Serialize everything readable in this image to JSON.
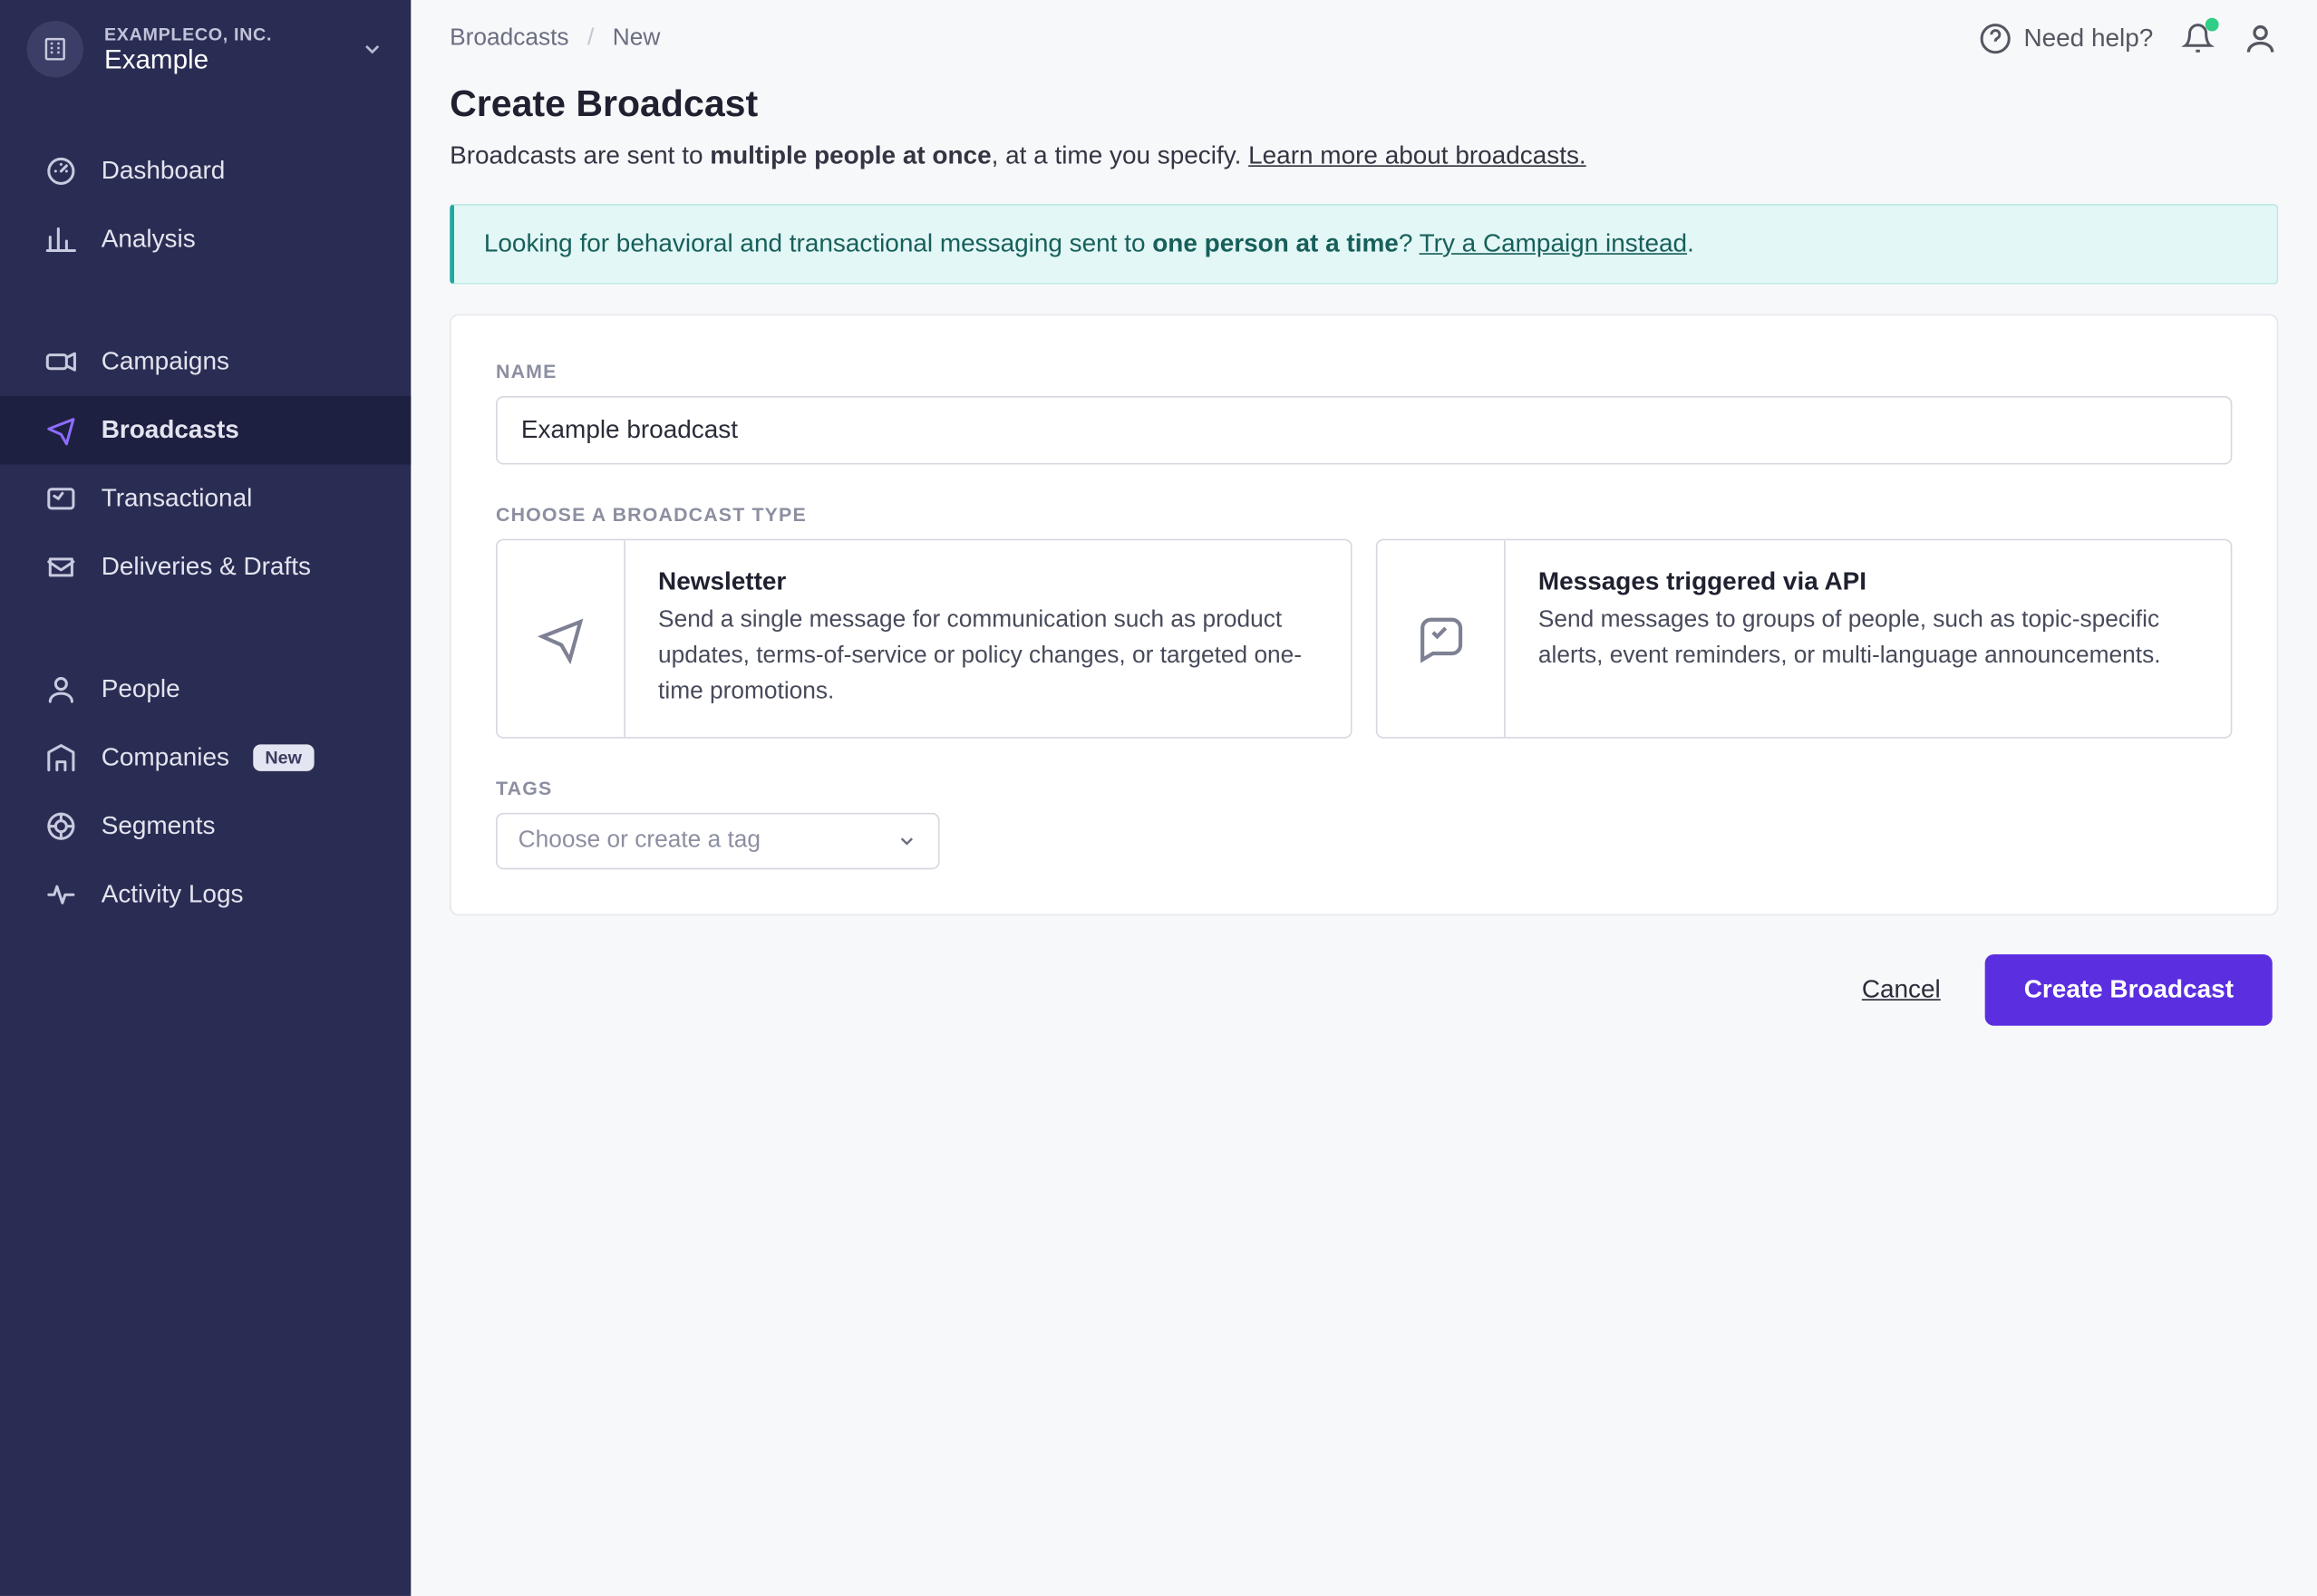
{
  "workspace": {
    "parent": "EXAMPLECO, INC.",
    "name": "Example"
  },
  "sidebar": {
    "groups": [
      [
        {
          "icon": "dashboard",
          "label": "Dashboard"
        },
        {
          "icon": "analysis",
          "label": "Analysis"
        }
      ],
      [
        {
          "icon": "campaigns",
          "label": "Campaigns"
        },
        {
          "icon": "broadcasts",
          "label": "Broadcasts",
          "active": true
        },
        {
          "icon": "transactional",
          "label": "Transactional"
        },
        {
          "icon": "deliveries",
          "label": "Deliveries & Drafts"
        }
      ],
      [
        {
          "icon": "people",
          "label": "People"
        },
        {
          "icon": "companies",
          "label": "Companies",
          "badge": "New"
        },
        {
          "icon": "segments",
          "label": "Segments"
        },
        {
          "icon": "activitylogs",
          "label": "Activity Logs"
        }
      ]
    ]
  },
  "breadcrumb": {
    "root": "Broadcasts",
    "current": "New"
  },
  "topbar": {
    "help": "Need help?"
  },
  "page": {
    "title": "Create Broadcast",
    "desc_a": "Broadcasts are sent to ",
    "desc_strong": "multiple people at once",
    "desc_b": ", at a time you specify. ",
    "desc_link": "Learn more about broadcasts."
  },
  "banner": {
    "a": "Looking for behavioral and transactional messaging sent to ",
    "strong": "one person at a time",
    "b": "? ",
    "link": "Try a Campaign instead",
    "c": "."
  },
  "form": {
    "name_label": "NAME",
    "name_value": "Example broadcast",
    "type_label": "CHOOSE A BROADCAST TYPE",
    "types": [
      {
        "title": "Newsletter",
        "desc": "Send a single message for communication such as product updates, terms-of-service or policy changes, or targeted one-time promotions."
      },
      {
        "title": "Messages triggered via API",
        "desc": "Send messages to groups of people, such as topic-specific alerts, event reminders, or multi-language announcements."
      }
    ],
    "tags_label": "TAGS",
    "tags_placeholder": "Choose or create a tag"
  },
  "actions": {
    "cancel": "Cancel",
    "submit": "Create Broadcast"
  }
}
